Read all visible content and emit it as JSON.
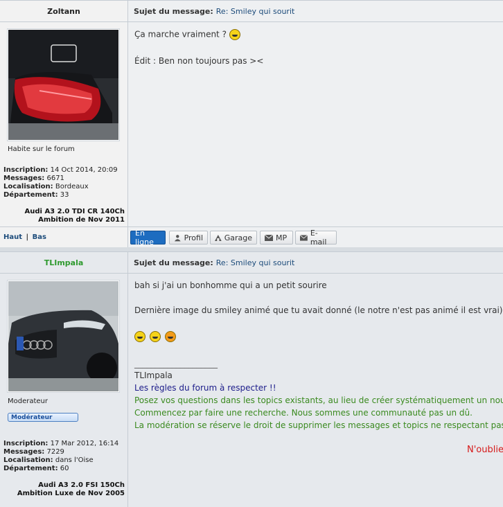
{
  "post1": {
    "author": "Zoltann",
    "subject_label": "Sujet du message:",
    "subject_value": "Re: Smiley qui sourit",
    "rank": "Habite sur le forum",
    "stats": {
      "inscription_label": "Inscription:",
      "inscription_value": "14 Oct 2014, 20:09",
      "messages_label": "Messages:",
      "messages_value": "6671",
      "localisation_label": "Localisation:",
      "localisation_value": "Bordeaux",
      "departement_label": "Département:",
      "departement_value": "33"
    },
    "car_line1": "Audi A3 2.0 TDI CR 140Ch",
    "car_line2": "Ambition de Nov 2011",
    "message_line1": "Ça marche vraiment ?",
    "message_line2": "Édit : Ben non toujours pas ><",
    "nav_haut": "Haut",
    "nav_sep": "|",
    "nav_bas": "Bas",
    "buttons": {
      "online": "En ligne",
      "profil": "Profil",
      "garage": "Garage",
      "mp": "MP",
      "email": "E-mail"
    }
  },
  "post2": {
    "author": "TLImpala",
    "subject_label": "Sujet du message:",
    "subject_value": "Re: Smiley qui sourit",
    "rank": "Moderateur",
    "badge": "Modérateur",
    "stats": {
      "inscription_label": "Inscription:",
      "inscription_value": "17 Mar 2012, 16:14",
      "messages_label": "Messages:",
      "messages_value": "7229",
      "localisation_label": "Localisation:",
      "localisation_value": "dans l'Oise",
      "departement_label": "Département:",
      "departement_value": "60"
    },
    "car_line1": "Audi A3 2.0 FSI 150Ch",
    "car_line2": "Ambition Luxe de Nov 2005",
    "message_line1": "bah si j'ai un bonhomme qui a un petit sourire",
    "message_line2": "Dernière image du smiley animé que tu avait donné (le notre n'est pas animé il est vrai)",
    "sig_rule": "____________________",
    "sig_name": "TLImpala",
    "sig_title": "Les règles du forum à respecter !!",
    "sig_line1": "Posez vos questions dans les topics existants, au lieu de créer systématiquement un nouveau",
    "sig_line2": "Commencez par faire une recherche. Nous sommes une communauté pas un dû.",
    "sig_line3": "La modération se réserve le droit de supprimer les messages et topics ne respectant pas les",
    "sig_red": "N'oubliez"
  },
  "colors": {
    "author2": "#2f9a2f",
    "link": "#1c4b7a",
    "online_button": "#1d6cc0"
  }
}
